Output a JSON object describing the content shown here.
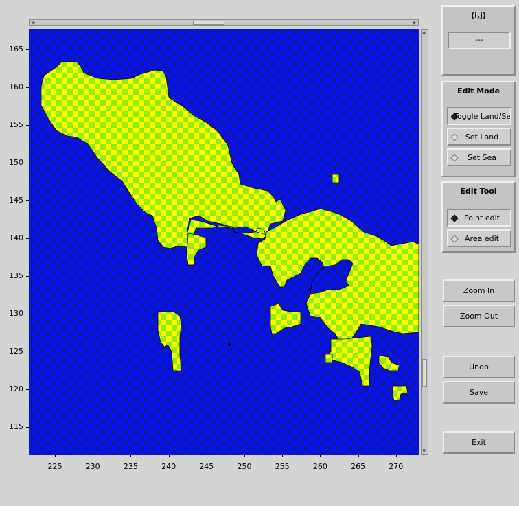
{
  "map": {
    "x_ticks": [
      "225",
      "230",
      "235",
      "240",
      "245",
      "250",
      "255",
      "260",
      "265",
      "270"
    ],
    "y_ticks": [
      "165",
      "160",
      "155",
      "150",
      "145",
      "140",
      "135",
      "130",
      "125",
      "120",
      "115"
    ],
    "colors": {
      "sea_a": "#0a10f0",
      "sea_b": "#0818b8",
      "land_a": "#ffff00",
      "land_b": "#90f000"
    }
  },
  "ij_panel": {
    "title": "(i,j)",
    "value": "---"
  },
  "edit_mode": {
    "title": "Edit Mode",
    "options": [
      {
        "label": "Toggle Land/Sea",
        "selected": true
      },
      {
        "label": "Set Land",
        "selected": false
      },
      {
        "label": "Set Sea",
        "selected": false
      }
    ]
  },
  "edit_tool": {
    "title": "Edit Tool",
    "options": [
      {
        "label": "Point edit",
        "selected": true
      },
      {
        "label": "Area edit",
        "selected": false
      }
    ]
  },
  "buttons": {
    "zoom_in": "Zoom In",
    "zoom_out": "Zoom Out",
    "undo": "Undo",
    "save": "Save",
    "exit": "Exit"
  }
}
